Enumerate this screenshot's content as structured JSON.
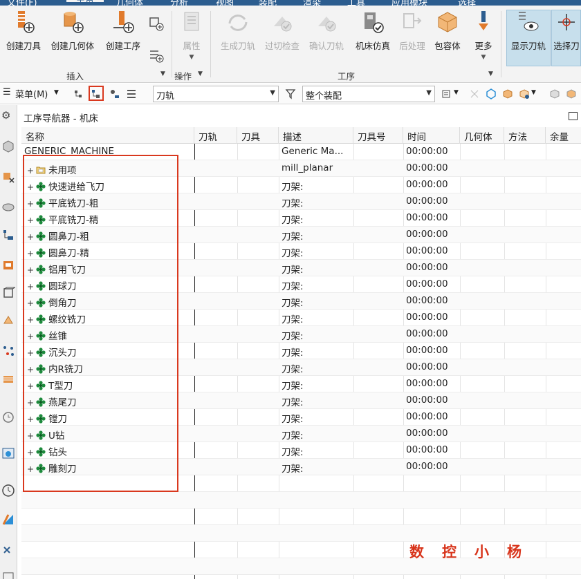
{
  "menu_tabs": [
    {
      "label": "文件(F)",
      "active": false
    },
    {
      "label": "主页",
      "active": true
    },
    {
      "label": "几何体",
      "active": false
    },
    {
      "label": "分析",
      "active": false
    },
    {
      "label": "视图",
      "active": false
    },
    {
      "label": "装配",
      "active": false
    },
    {
      "label": "渲染",
      "active": false
    },
    {
      "label": "工具",
      "active": false
    },
    {
      "label": "应用模块",
      "active": false
    },
    {
      "label": "选择",
      "active": false
    }
  ],
  "ribbon": {
    "buttons": [
      {
        "id": "create-tool",
        "label": "创建刀具",
        "enabled": true
      },
      {
        "id": "create-geometry",
        "label": "创建几何体",
        "enabled": true
      },
      {
        "id": "create-operation",
        "label": "创建工序",
        "enabled": true
      },
      {
        "id": "properties",
        "label": "属性",
        "enabled": false
      },
      {
        "id": "generate-toolpath",
        "label": "生成刀轨",
        "enabled": false
      },
      {
        "id": "gouge-check",
        "label": "过切检查",
        "enabled": false
      },
      {
        "id": "verify-toolpath",
        "label": "确认刀轨",
        "enabled": false
      },
      {
        "id": "machine-simulation",
        "label": "机床仿真",
        "enabled": true
      },
      {
        "id": "postprocess",
        "label": "后处理",
        "enabled": false
      },
      {
        "id": "bounding-body",
        "label": "包容体",
        "enabled": true
      },
      {
        "id": "more",
        "label": "更多",
        "enabled": true
      },
      {
        "id": "show-toolpath",
        "label": "显示刀轨",
        "enabled": true,
        "highlighted": true
      },
      {
        "id": "select-tool",
        "label": "选择刀",
        "enabled": true
      }
    ],
    "groups": {
      "insert": "插入",
      "operation": "操作",
      "process": "工序"
    }
  },
  "toolbar2": {
    "menu_label": "菜单(M)",
    "filter_combo": "刀轨",
    "scope_combo": "整个装配"
  },
  "navigator": {
    "title": "工序导航器 - 机床",
    "columns": [
      "名称",
      "刀轨",
      "刀具",
      "描述",
      "刀具号",
      "时间",
      "几何体",
      "方法",
      "余量"
    ],
    "root": {
      "name": "GENERIC_MACHINE",
      "desc": "Generic Ma...",
      "time": "00:00:00"
    },
    "rows": [
      {
        "name": "未用项",
        "type": "folder",
        "desc": "mill_planar",
        "time": "00:00:00"
      },
      {
        "name": "快速进给飞刀",
        "type": "pocket",
        "desc": "刀架:",
        "time": "00:00:00"
      },
      {
        "name": "平底铣刀-粗",
        "type": "pocket",
        "desc": "刀架:",
        "time": "00:00:00"
      },
      {
        "name": "平底铣刀-精",
        "type": "pocket",
        "desc": "刀架:",
        "time": "00:00:00"
      },
      {
        "name": "圆鼻刀-粗",
        "type": "pocket",
        "desc": "刀架:",
        "time": "00:00:00"
      },
      {
        "name": "圆鼻刀-精",
        "type": "pocket",
        "desc": "刀架:",
        "time": "00:00:00"
      },
      {
        "name": "铝用飞刀",
        "type": "pocket",
        "desc": "刀架:",
        "time": "00:00:00"
      },
      {
        "name": "圆球刀",
        "type": "pocket",
        "desc": "刀架:",
        "time": "00:00:00"
      },
      {
        "name": "倒角刀",
        "type": "pocket",
        "desc": "刀架:",
        "time": "00:00:00"
      },
      {
        "name": "螺纹铣刀",
        "type": "pocket",
        "desc": "刀架:",
        "time": "00:00:00"
      },
      {
        "name": "丝锥",
        "type": "pocket",
        "desc": "刀架:",
        "time": "00:00:00"
      },
      {
        "name": "沉头刀",
        "type": "pocket",
        "desc": "刀架:",
        "time": "00:00:00"
      },
      {
        "name": "内R铣刀",
        "type": "pocket",
        "desc": "刀架:",
        "time": "00:00:00"
      },
      {
        "name": "T型刀",
        "type": "pocket",
        "desc": "刀架:",
        "time": "00:00:00"
      },
      {
        "name": "燕尾刀",
        "type": "pocket",
        "desc": "刀架:",
        "time": "00:00:00"
      },
      {
        "name": "镗刀",
        "type": "pocket",
        "desc": "刀架:",
        "time": "00:00:00"
      },
      {
        "name": "U钻",
        "type": "pocket",
        "desc": "刀架:",
        "time": "00:00:00"
      },
      {
        "name": "钻头",
        "type": "pocket",
        "desc": "刀架:",
        "time": "00:00:00"
      },
      {
        "name": "雕刻刀",
        "type": "pocket",
        "desc": "刀架:",
        "time": "00:00:00"
      }
    ]
  },
  "watermark": [
    "数",
    "控",
    "小",
    "杨"
  ],
  "colors": {
    "accent_red": "#d9381e",
    "pocket_green": "#1d8a3c",
    "ribbon_bg": "#f3f3f3",
    "menu_blue": "#2c5d8f"
  }
}
